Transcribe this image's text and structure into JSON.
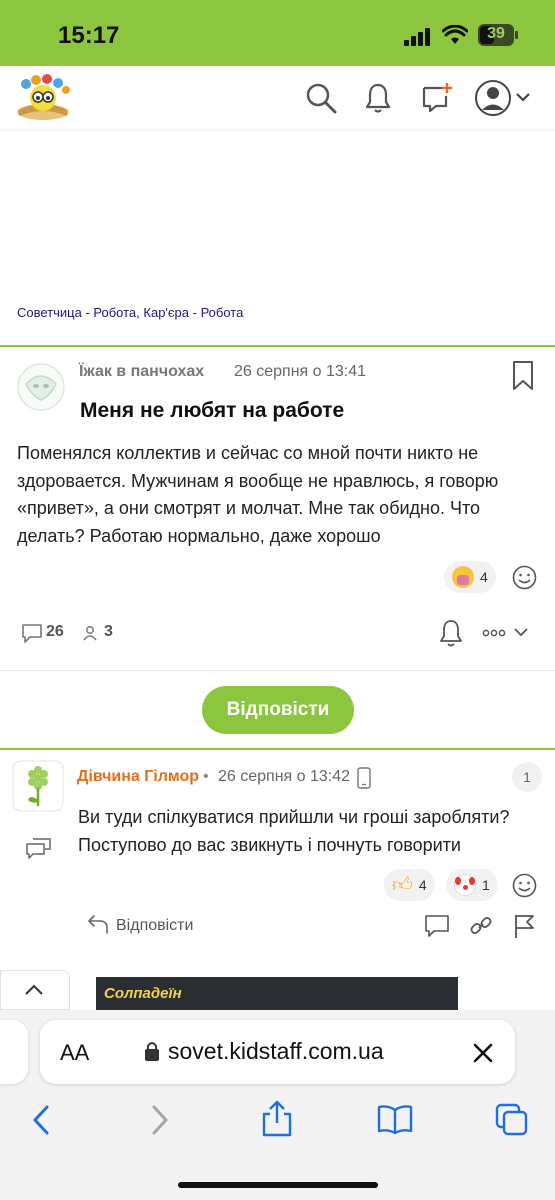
{
  "status_bar": {
    "time": "15:17",
    "battery": "39"
  },
  "breadcrumb": {
    "items": [
      "Советчица",
      "Робота, Кар'єра",
      "Робота"
    ],
    "separator": " - "
  },
  "post": {
    "author": "Їжак в панчохах",
    "date": "26 серпня о 13:41",
    "title": "Меня не любят на работе",
    "body": "Поменялся коллектив и сейчас со мной почти никто не здоровается. Мужчинам я вообще не нравлюсь, я говорю «привет», а они смотрят и молчат. Мне так обидно. Что делать? Работаю нормально, даже хорошо",
    "reaction_count": "4",
    "comments_count": "26",
    "participants_count": "3"
  },
  "reply_button": "Відповісти",
  "comment": {
    "author": "Дівчина Гілмор",
    "date": "26 серпня о 13:42",
    "number": "1",
    "text": "Ви туди спілкуватися прийшли чи гроші заробляти? Поступово до вас звикнуть і почнуть говорити",
    "reactions": [
      {
        "icon": "thumbs-up",
        "count": "4"
      },
      {
        "icon": "clown-face",
        "count": "1"
      }
    ],
    "reply_label": "Відповісти"
  },
  "ad_banner": {
    "text": "Солпадеїн"
  },
  "browser": {
    "text_size_label": "AA",
    "url": "sovet.kidstaff.com.ua"
  },
  "colors": {
    "accent_green": "#8cc63f",
    "author_orange": "#e07020",
    "link_blue": "#1a1a80"
  }
}
